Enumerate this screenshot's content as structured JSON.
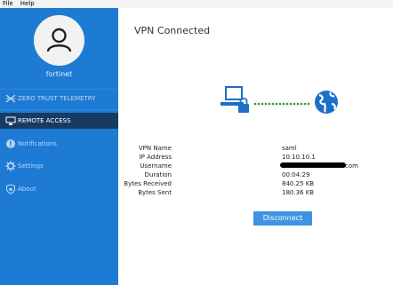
{
  "menu": {
    "file": "File",
    "help": "Help"
  },
  "sidebar": {
    "username": "fortinet",
    "items": [
      {
        "label": "ZERO TRUST TELEMETRY",
        "icon": "telemetry-icon"
      },
      {
        "label": "REMOTE ACCESS",
        "icon": "remote-access-icon"
      },
      {
        "label": "Notifications",
        "icon": "alert-icon"
      },
      {
        "label": "Settings",
        "icon": "gear-icon"
      },
      {
        "label": "About",
        "icon": "shield-icon"
      }
    ]
  },
  "main": {
    "title": "VPN Connected",
    "info": [
      {
        "key": "VPN Name",
        "value": "saml"
      },
      {
        "key": "IP Address",
        "value": "10.10.10.1"
      },
      {
        "key": "Username",
        "value": "com"
      },
      {
        "key": "Duration",
        "value": "00:04:29"
      },
      {
        "key": "Bytes Received",
        "value": "840.25 KB"
      },
      {
        "key": "Bytes Sent",
        "value": "180.36 KB"
      }
    ],
    "disconnect_label": "Disconnect"
  },
  "colors": {
    "sidebar": "#1d7bd4",
    "active": "#173b62",
    "button": "#3f93e1",
    "connection": "#2e9e2e"
  }
}
